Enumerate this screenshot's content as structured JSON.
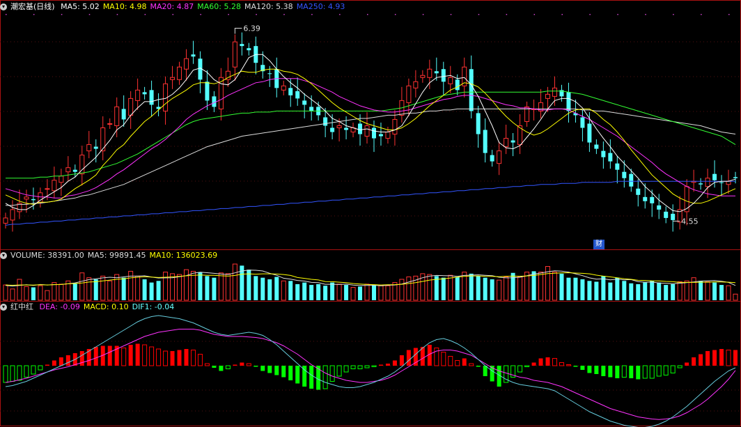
{
  "header": {
    "main": {
      "title": "潮宏基(日线)",
      "items": [
        {
          "label": "MA5: 5.02",
          "color": "#ffffff"
        },
        {
          "label": "MA10: 4.98",
          "color": "#ffff00"
        },
        {
          "label": "MA20: 4.87",
          "color": "#ff33ff"
        },
        {
          "label": "MA60: 5.28",
          "color": "#33ff33"
        },
        {
          "label": "MA120: 5.38",
          "color": "#dddddd"
        },
        {
          "label": "MA250: 4.93",
          "color": "#3355ff"
        }
      ]
    },
    "volume": {
      "items": [
        {
          "label": "VOLUME: 38391.00",
          "color": "#dddddd"
        },
        {
          "label": "MA5: 99891.45",
          "color": "#dddddd"
        },
        {
          "label": "MA10: 136023.69",
          "color": "#ffff00"
        }
      ]
    },
    "macd": {
      "title": "红中红",
      "items": [
        {
          "label": "DEA: -0.09",
          "color": "#ff33ff"
        },
        {
          "label": "MACD: 0.10",
          "color": "#ffff00"
        },
        {
          "label": "DIF1: -0.04",
          "color": "#66ffff"
        }
      ]
    }
  },
  "annotations": {
    "high": "6.39",
    "low": "4.55",
    "caiwu": "财"
  },
  "colors": {
    "up": "#ff3232",
    "down": "#54ffff",
    "ma5": "#ffffff",
    "ma10": "#ffff00",
    "ma20": "#ff33ff",
    "ma60": "#33ff33",
    "ma120": "#dddddd",
    "ma250": "#3355ff",
    "macd_up": "#ff0000",
    "macd_down": "#00ff00"
  },
  "chart_data": {
    "type": "candlestick",
    "ylim": [
      4.4,
      6.5
    ],
    "close": [
      4.58,
      4.66,
      4.72,
      4.78,
      4.75,
      4.82,
      4.86,
      4.94,
      4.98,
      5.06,
      5.02,
      5.18,
      5.28,
      5.24,
      5.44,
      5.48,
      5.64,
      5.52,
      5.72,
      5.8,
      5.76,
      5.66,
      5.62,
      5.86,
      5.92,
      6.02,
      6.1,
      6.12,
      5.9,
      5.7,
      5.64,
      5.92,
      5.98,
      6.26,
      6.22,
      6.18,
      6.06,
      5.98,
      5.96,
      5.82,
      5.84,
      5.75,
      5.72,
      5.66,
      5.6,
      5.56,
      5.46,
      5.4,
      5.46,
      5.42,
      5.44,
      5.38,
      5.46,
      5.34,
      5.36,
      5.4,
      5.52,
      5.7,
      5.84,
      5.88,
      5.94,
      6.0,
      5.96,
      5.88,
      5.92,
      5.8,
      6.02,
      5.6,
      5.38,
      5.2,
      5.12,
      5.22,
      5.34,
      5.3,
      5.46,
      5.64,
      5.62,
      5.68,
      5.76,
      5.82,
      5.74,
      5.6,
      5.56,
      5.44,
      5.3,
      5.24,
      5.16,
      5.12,
      5.04,
      4.96,
      4.88,
      4.8,
      4.74,
      4.72,
      4.66,
      4.58,
      4.56,
      4.66,
      4.88,
      4.93,
      4.9,
      4.96,
      4.94,
      4.92,
      4.93,
      4.96
    ],
    "ma5": [
      4.72,
      4.68,
      4.66,
      4.66,
      4.7,
      4.75,
      4.79,
      4.83,
      4.87,
      4.93,
      4.97,
      5.04,
      5.1,
      5.16,
      5.24,
      5.32,
      5.42,
      5.47,
      5.56,
      5.63,
      5.69,
      5.69,
      5.71,
      5.72,
      5.76,
      5.82,
      5.9,
      5.99,
      6.01,
      5.97,
      5.9,
      5.86,
      5.85,
      5.9,
      6.0,
      6.11,
      6.14,
      6.14,
      6.08,
      6.0,
      5.93,
      5.87,
      5.82,
      5.76,
      5.71,
      5.66,
      5.6,
      5.53,
      5.5,
      5.46,
      5.44,
      5.42,
      5.43,
      5.41,
      5.4,
      5.4,
      5.42,
      5.46,
      5.56,
      5.67,
      5.78,
      5.87,
      5.92,
      5.93,
      5.94,
      5.91,
      5.92,
      5.85,
      5.74,
      5.6,
      5.46,
      5.3,
      5.25,
      5.24,
      5.27,
      5.35,
      5.43,
      5.52,
      5.62,
      5.7,
      5.72,
      5.72,
      5.69,
      5.63,
      5.53,
      5.43,
      5.34,
      5.26,
      5.17,
      5.1,
      5.03,
      4.96,
      4.88,
      4.82,
      4.75,
      4.7,
      4.65,
      4.64,
      4.67,
      4.72,
      4.79,
      4.87,
      4.92,
      4.93,
      4.93,
      4.95
    ],
    "ma10": [
      4.8,
      4.77,
      4.74,
      4.72,
      4.71,
      4.73,
      4.73,
      4.74,
      4.76,
      4.81,
      4.86,
      4.9,
      4.94,
      4.99,
      5.08,
      5.15,
      5.23,
      5.28,
      5.36,
      5.43,
      5.5,
      5.55,
      5.61,
      5.67,
      5.72,
      5.76,
      5.8,
      5.85,
      5.87,
      5.87,
      5.86,
      5.88,
      5.92,
      5.95,
      5.98,
      5.97,
      5.97,
      5.99,
      6.0,
      6.0,
      5.98,
      5.97,
      5.95,
      5.91,
      5.86,
      5.8,
      5.74,
      5.68,
      5.63,
      5.59,
      5.55,
      5.51,
      5.48,
      5.46,
      5.44,
      5.42,
      5.42,
      5.44,
      5.48,
      5.53,
      5.59,
      5.65,
      5.7,
      5.75,
      5.8,
      5.83,
      5.87,
      5.86,
      5.83,
      5.77,
      5.7,
      5.62,
      5.55,
      5.49,
      5.44,
      5.4,
      5.37,
      5.39,
      5.43,
      5.48,
      5.53,
      5.58,
      5.61,
      5.62,
      5.62,
      5.58,
      5.52,
      5.47,
      5.4,
      5.32,
      5.23,
      5.15,
      5.07,
      4.99,
      4.93,
      4.87,
      4.81,
      4.77,
      4.74,
      4.72,
      4.72,
      4.74,
      4.77,
      4.8,
      4.83,
      4.86
    ],
    "ma20": [
      4.86,
      4.84,
      4.82,
      4.8,
      4.79,
      4.78,
      4.78,
      4.77,
      4.77,
      4.79,
      4.8,
      4.82,
      4.84,
      4.87,
      4.91,
      4.95,
      5.0,
      5.04,
      5.09,
      5.14,
      5.19,
      5.24,
      5.28,
      5.33,
      5.39,
      5.45,
      5.52,
      5.57,
      5.61,
      5.65,
      5.68,
      5.71,
      5.75,
      5.78,
      5.81,
      5.84,
      5.87,
      5.88,
      5.9,
      5.91,
      5.91,
      5.91,
      5.91,
      5.89,
      5.87,
      5.84,
      5.81,
      5.78,
      5.74,
      5.71,
      5.68,
      5.65,
      5.63,
      5.61,
      5.6,
      5.59,
      5.59,
      5.6,
      5.61,
      5.63,
      5.65,
      5.67,
      5.69,
      5.71,
      5.72,
      5.74,
      5.75,
      5.75,
      5.74,
      5.72,
      5.7,
      5.68,
      5.66,
      5.65,
      5.63,
      5.63,
      5.62,
      5.61,
      5.61,
      5.62,
      5.62,
      5.61,
      5.58,
      5.55,
      5.52,
      5.48,
      5.44,
      5.4,
      5.36,
      5.31,
      5.26,
      5.21,
      5.16,
      5.11,
      5.05,
      5.0,
      4.96,
      4.92,
      4.88,
      4.85,
      4.83,
      4.81,
      4.8,
      4.79,
      4.79,
      4.79
    ],
    "ma60": [
      4.96,
      4.96,
      4.96,
      4.96,
      4.96,
      4.97,
      4.97,
      4.98,
      4.98,
      4.99,
      5.0,
      5.01,
      5.02,
      5.04,
      5.06,
      5.08,
      5.1,
      5.13,
      5.16,
      5.19,
      5.23,
      5.27,
      5.31,
      5.35,
      5.39,
      5.43,
      5.47,
      5.5,
      5.52,
      5.53,
      5.54,
      5.55,
      5.56,
      5.57,
      5.58,
      5.58,
      5.59,
      5.59,
      5.59,
      5.6,
      5.6,
      5.6,
      5.6,
      5.6,
      5.6,
      5.6,
      5.6,
      5.6,
      5.6,
      5.6,
      5.6,
      5.6,
      5.6,
      5.6,
      5.6,
      5.61,
      5.62,
      5.63,
      5.65,
      5.67,
      5.69,
      5.71,
      5.73,
      5.75,
      5.76,
      5.77,
      5.78,
      5.78,
      5.78,
      5.78,
      5.78,
      5.78,
      5.78,
      5.78,
      5.78,
      5.78,
      5.78,
      5.78,
      5.79,
      5.79,
      5.79,
      5.78,
      5.77,
      5.76,
      5.74,
      5.72,
      5.7,
      5.68,
      5.66,
      5.64,
      5.62,
      5.6,
      5.58,
      5.56,
      5.54,
      5.52,
      5.5,
      5.48,
      5.46,
      5.44,
      5.42,
      5.4,
      5.38,
      5.36,
      5.32,
      5.28
    ],
    "ma120": [
      4.7,
      4.7,
      4.71,
      4.71,
      4.72,
      4.72,
      4.73,
      4.74,
      4.75,
      4.76,
      4.77,
      4.79,
      4.8,
      4.82,
      4.84,
      4.86,
      4.88,
      4.9,
      4.93,
      4.96,
      4.99,
      5.02,
      5.05,
      5.08,
      5.11,
      5.14,
      5.17,
      5.2,
      5.23,
      5.26,
      5.28,
      5.3,
      5.32,
      5.34,
      5.36,
      5.37,
      5.38,
      5.39,
      5.4,
      5.41,
      5.42,
      5.43,
      5.44,
      5.45,
      5.46,
      5.47,
      5.48,
      5.49,
      5.5,
      5.51,
      5.52,
      5.53,
      5.53,
      5.54,
      5.55,
      5.56,
      5.56,
      5.57,
      5.58,
      5.58,
      5.59,
      5.6,
      5.6,
      5.61,
      5.61,
      5.62,
      5.62,
      5.62,
      5.62,
      5.62,
      5.62,
      5.62,
      5.62,
      5.62,
      5.62,
      5.62,
      5.62,
      5.62,
      5.62,
      5.62,
      5.62,
      5.62,
      5.62,
      5.61,
      5.61,
      5.6,
      5.6,
      5.59,
      5.58,
      5.57,
      5.56,
      5.55,
      5.54,
      5.53,
      5.52,
      5.51,
      5.5,
      5.49,
      5.48,
      5.47,
      5.46,
      5.44,
      5.42,
      5.4,
      5.39,
      5.38
    ],
    "ma250": [
      4.51,
      4.52,
      4.52,
      4.53,
      4.53,
      4.54,
      4.54,
      4.55,
      4.55,
      4.56,
      4.56,
      4.57,
      4.57,
      4.58,
      4.58,
      4.59,
      4.59,
      4.6,
      4.6,
      4.61,
      4.61,
      4.62,
      4.62,
      4.63,
      4.63,
      4.64,
      4.64,
      4.65,
      4.65,
      4.66,
      4.66,
      4.67,
      4.67,
      4.68,
      4.68,
      4.69,
      4.69,
      4.7,
      4.7,
      4.71,
      4.71,
      4.72,
      4.72,
      4.73,
      4.73,
      4.74,
      4.74,
      4.75,
      4.75,
      4.76,
      4.76,
      4.77,
      4.77,
      4.78,
      4.78,
      4.79,
      4.79,
      4.8,
      4.8,
      4.81,
      4.81,
      4.82,
      4.82,
      4.83,
      4.83,
      4.84,
      4.84,
      4.85,
      4.85,
      4.86,
      4.86,
      4.87,
      4.87,
      4.88,
      4.88,
      4.89,
      4.89,
      4.9,
      4.9,
      4.9,
      4.91,
      4.91,
      4.91,
      4.92,
      4.92,
      4.92,
      4.92,
      4.92,
      4.93,
      4.93,
      4.93,
      4.93,
      4.93,
      4.93,
      4.93,
      4.93,
      4.93,
      4.93,
      4.93,
      4.93,
      4.93,
      4.93,
      4.93,
      4.93,
      4.93,
      4.93
    ],
    "volume": [
      95,
      70,
      130,
      85,
      80,
      90,
      60,
      110,
      100,
      120,
      105,
      170,
      140,
      130,
      150,
      120,
      160,
      140,
      180,
      150,
      130,
      110,
      120,
      175,
      165,
      160,
      190,
      180,
      175,
      150,
      140,
      170,
      165,
      225,
      215,
      190,
      150,
      140,
      130,
      145,
      120,
      120,
      100,
      110,
      95,
      100,
      90,
      110,
      100,
      95,
      80,
      85,
      100,
      95,
      90,
      90,
      110,
      130,
      145,
      150,
      165,
      160,
      150,
      140,
      155,
      145,
      175,
      165,
      150,
      140,
      130,
      125,
      145,
      170,
      145,
      175,
      180,
      175,
      210,
      175,
      165,
      140,
      140,
      130,
      120,
      115,
      150,
      110,
      140,
      120,
      105,
      100,
      110,
      120,
      110,
      95,
      100,
      115,
      120,
      140,
      120,
      115,
      110,
      95,
      90,
      38
    ],
    "vol_ma5": [
      92,
      88,
      92,
      96,
      92,
      98,
      95,
      97,
      98,
      102,
      108,
      118,
      128,
      133,
      139,
      143,
      140,
      145,
      150,
      150,
      152,
      144,
      138,
      139,
      140,
      146,
      153,
      168,
      174,
      171,
      167,
      163,
      160,
      170,
      182,
      187,
      186,
      182,
      167,
      155,
      137,
      131,
      123,
      119,
      111,
      109,
      99,
      99,
      98,
      100,
      94,
      92,
      92,
      93,
      90,
      93,
      95,
      101,
      113,
      125,
      140,
      150,
      154,
      153,
      152,
      148,
      154,
      156,
      158,
      155,
      153,
      143,
      139,
      140,
      143,
      152,
      163,
      169,
      177,
      183,
      181,
      175,
      164,
      153,
      139,
      131,
      133,
      127,
      131,
      127,
      128,
      115,
      112,
      113,
      107,
      105,
      103,
      106,
      109,
      114,
      119,
      121,
      122,
      118,
      111,
      92
    ],
    "vol_ma10": [
      95,
      93,
      95,
      95,
      94,
      96,
      95,
      97,
      98,
      102,
      104,
      107,
      113,
      115,
      120,
      125,
      130,
      133,
      139,
      143,
      146,
      144,
      141,
      143,
      145,
      148,
      152,
      155,
      157,
      155,
      155,
      152,
      150,
      154,
      162,
      164,
      162,
      164,
      164,
      163,
      160,
      154,
      141,
      136,
      130,
      126,
      116,
      115,
      112,
      109,
      104,
      101,
      98,
      97,
      95,
      96,
      97,
      99,
      104,
      109,
      117,
      125,
      130,
      133,
      138,
      144,
      148,
      151,
      151,
      149,
      148,
      146,
      149,
      150,
      149,
      151,
      154,
      160,
      166,
      168,
      170,
      171,
      169,
      167,
      164,
      156,
      150,
      145,
      140,
      134,
      130,
      124,
      123,
      121,
      120,
      117,
      115,
      111,
      111,
      111,
      112,
      112,
      114,
      114,
      112,
      109
    ],
    "macd_hist": [
      -0.32,
      -0.3,
      -0.28,
      -0.22,
      -0.16,
      -0.08,
      0.02,
      0.1,
      0.16,
      0.2,
      0.24,
      0.28,
      0.32,
      0.36,
      0.38,
      0.38,
      0.38,
      0.34,
      0.4,
      0.42,
      0.4,
      0.36,
      0.32,
      0.28,
      0.28,
      0.3,
      0.32,
      0.3,
      0.22,
      0.04,
      -0.04,
      -0.1,
      -0.06,
      0.02,
      0.06,
      0.04,
      -0.02,
      -0.1,
      -0.14,
      -0.18,
      -0.22,
      -0.28,
      -0.34,
      -0.4,
      -0.44,
      -0.46,
      -0.44,
      -0.3,
      -0.2,
      -0.12,
      -0.06,
      -0.06,
      -0.04,
      -0.02,
      0.02,
      0.04,
      0.1,
      0.2,
      0.3,
      0.34,
      0.36,
      0.4,
      0.34,
      0.26,
      0.18,
      0.1,
      0.14,
      0.04,
      -0.02,
      -0.2,
      -0.3,
      -0.4,
      -0.32,
      -0.22,
      -0.12,
      -0.02,
      0.06,
      0.14,
      0.16,
      0.14,
      0.06,
      0.02,
      -0.02,
      -0.08,
      -0.14,
      -0.16,
      -0.2,
      -0.22,
      -0.24,
      -0.22,
      -0.24,
      -0.26,
      -0.24,
      -0.24,
      -0.2,
      -0.18,
      -0.14,
      -0.04,
      0.06,
      0.16,
      0.22,
      0.28,
      0.3,
      0.32,
      0.3,
      0.3
    ],
    "dea": [
      -0.32,
      -0.3,
      -0.27,
      -0.24,
      -0.2,
      -0.16,
      -0.12,
      -0.08,
      -0.05,
      -0.02,
      0.02,
      0.06,
      0.1,
      0.15,
      0.2,
      0.26,
      0.32,
      0.38,
      0.44,
      0.5,
      0.56,
      0.6,
      0.64,
      0.66,
      0.68,
      0.7,
      0.7,
      0.7,
      0.68,
      0.64,
      0.6,
      0.58,
      0.56,
      0.56,
      0.56,
      0.55,
      0.54,
      0.52,
      0.48,
      0.44,
      0.38,
      0.3,
      0.22,
      0.12,
      0.02,
      -0.06,
      -0.14,
      -0.2,
      -0.24,
      -0.28,
      -0.3,
      -0.32,
      -0.32,
      -0.3,
      -0.28,
      -0.24,
      -0.18,
      -0.1,
      -0.02,
      0.06,
      0.14,
      0.22,
      0.28,
      0.3,
      0.3,
      0.28,
      0.24,
      0.2,
      0.12,
      0.04,
      -0.04,
      -0.1,
      -0.14,
      -0.18,
      -0.22,
      -0.24,
      -0.28,
      -0.3,
      -0.32,
      -0.36,
      -0.4,
      -0.46,
      -0.52,
      -0.58,
      -0.64,
      -0.7,
      -0.76,
      -0.82,
      -0.86,
      -0.9,
      -0.94,
      -0.98,
      -1.0,
      -1.02,
      -1.03,
      -1.02,
      -1.0,
      -0.96,
      -0.9,
      -0.82,
      -0.74,
      -0.64,
      -0.52,
      -0.4,
      -0.26,
      -0.09
    ],
    "dif": [
      -0.4,
      -0.38,
      -0.34,
      -0.3,
      -0.24,
      -0.18,
      -0.12,
      -0.06,
      0.0,
      0.06,
      0.12,
      0.2,
      0.28,
      0.36,
      0.44,
      0.52,
      0.6,
      0.68,
      0.76,
      0.84,
      0.9,
      0.94,
      0.96,
      0.94,
      0.92,
      0.9,
      0.86,
      0.82,
      0.76,
      0.7,
      0.64,
      0.6,
      0.58,
      0.6,
      0.62,
      0.64,
      0.62,
      0.58,
      0.5,
      0.4,
      0.28,
      0.16,
      0.04,
      -0.08,
      -0.18,
      -0.26,
      -0.32,
      -0.36,
      -0.4,
      -0.42,
      -0.42,
      -0.4,
      -0.36,
      -0.32,
      -0.26,
      -0.2,
      -0.12,
      -0.02,
      0.1,
      0.22,
      0.34,
      0.44,
      0.5,
      0.52,
      0.48,
      0.42,
      0.34,
      0.24,
      0.12,
      0.0,
      -0.1,
      -0.18,
      -0.26,
      -0.32,
      -0.36,
      -0.38,
      -0.4,
      -0.42,
      -0.44,
      -0.48,
      -0.56,
      -0.64,
      -0.72,
      -0.8,
      -0.88,
      -0.94,
      -1.0,
      -1.06,
      -1.1,
      -1.14,
      -1.16,
      -1.18,
      -1.18,
      -1.16,
      -1.12,
      -1.06,
      -0.98,
      -0.88,
      -0.78,
      -0.66,
      -0.54,
      -0.42,
      -0.3,
      -0.2,
      -0.1,
      -0.04
    ]
  }
}
